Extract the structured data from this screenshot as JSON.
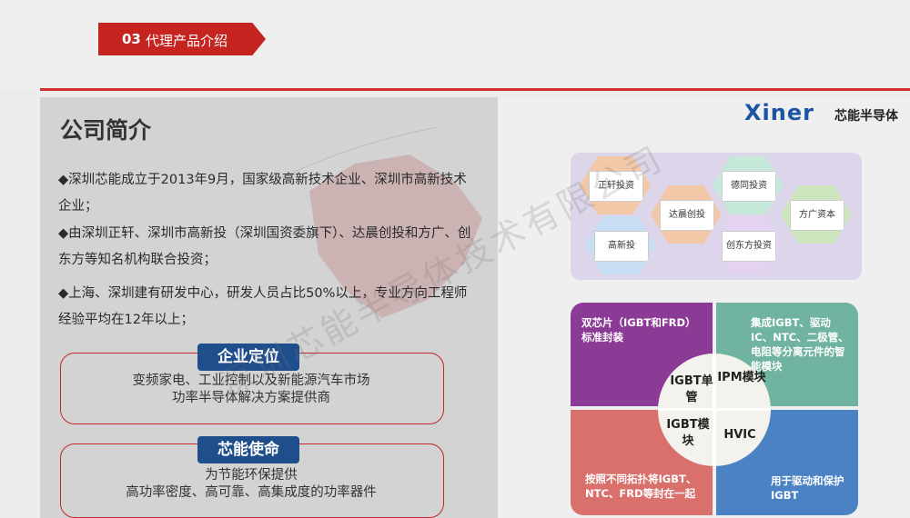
{
  "header": {
    "section_num": "03",
    "section_title": "代理产品介绍"
  },
  "left": {
    "title": "公司简介",
    "paragraphs": [
      "◆深圳芯能成立于2013年9月，国家级高新技术企业、深圳市高新技术企业；",
      "◆由深圳正轩、深圳市高新投（深圳国资委旗下）、达晨创投和方广、创东方等知名机构联合投资；",
      "◆上海、深圳建有研发中心，研发人员占比50%以上，专业方向工程师经验平均在12年以上；"
    ],
    "position_box": {
      "label": "企业定位",
      "line1": "变频家电、工业控制以及新能源汽车市场",
      "line2": "功率半导体解决方案提供商"
    },
    "mission_box": {
      "label": "芯能使命",
      "line1": "为节能环保提供",
      "line2": "高功率密度、高可靠、高集成度的功率器件"
    }
  },
  "logo": {
    "en": "Xiner",
    "cn": "芯能半导体"
  },
  "investors": [
    "正轩投资",
    "达晨创投",
    "德同投资",
    "方广资本",
    "高新投",
    "创东方投资"
  ],
  "quadrants": {
    "tl": {
      "text": "双芯片（IGBT和FRD）标准封装",
      "color": "#8b3a96"
    },
    "tr": {
      "text": "集成IGBT、驱动IC、NTC、二极管、电阻等分离元件的智能模块",
      "color": "#6fb3a0"
    },
    "bl": {
      "text": "按照不同拓扑将IGBT、NTC、FRD等封在一起",
      "color": "#d9706c"
    },
    "br": {
      "text": "用于驱动和保护IGBT",
      "color": "#4b82c4"
    }
  },
  "center": {
    "tl": "IGBT单管",
    "tr": "IPM模块",
    "bl": "IGBT模块",
    "br": "HVIC"
  },
  "watermark": "深圳芯能半导体技术有限公司"
}
